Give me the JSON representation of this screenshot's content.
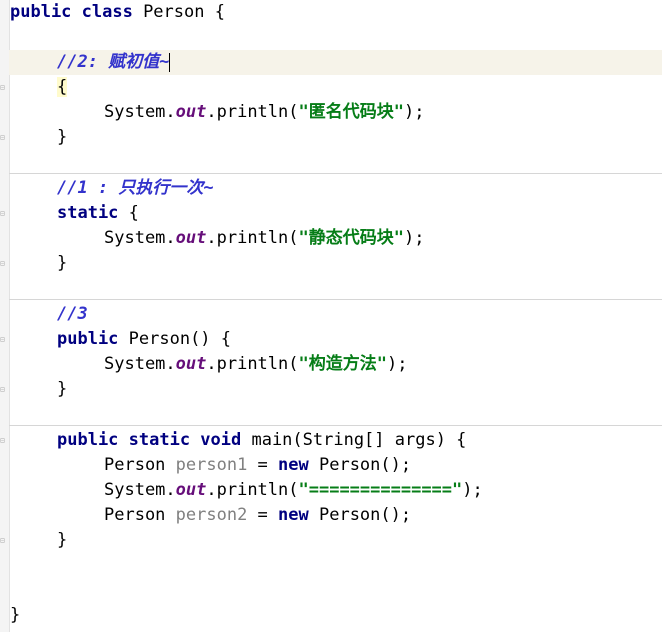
{
  "code": {
    "class_decl": {
      "kw": "public class",
      "name": " Person {"
    },
    "block1": {
      "comment": "//2: 赋初值~",
      "open": "{",
      "stmt_pre": "System.",
      "stmt_field": "out",
      "stmt_mid": ".println(",
      "stmt_str": "\"匿名代码块\"",
      "stmt_end": ");",
      "close": "}"
    },
    "block2": {
      "comment": "//1 : 只执行一次~",
      "kw": "static",
      "open": " {",
      "stmt_pre": "System.",
      "stmt_field": "out",
      "stmt_mid": ".println(",
      "stmt_str": "\"静态代码块\"",
      "stmt_end": ");",
      "close": "}"
    },
    "block3": {
      "comment": "//3",
      "kw": "public",
      "sig": " Person() {",
      "stmt_pre": "System.",
      "stmt_field": "out",
      "stmt_mid": ".println(",
      "stmt_str": "\"构造方法\"",
      "stmt_end": ");",
      "close": "}"
    },
    "main": {
      "kw": "public static void",
      "sig": " main(String[] args) {",
      "l1_type": "Person ",
      "l1_var": "person1",
      "l1_eq": " = ",
      "l1_new": "new",
      "l1_end": " Person();",
      "l2_pre": "System.",
      "l2_field": "out",
      "l2_mid": ".println(",
      "l2_str": "\"==============\"",
      "l2_end": ");",
      "l3_type": "Person ",
      "l3_var": "person2",
      "l3_eq": " = ",
      "l3_new": "new",
      "l3_end": " Person();",
      "close": "}"
    },
    "class_close": "}"
  },
  "colors": {
    "keyword": "#000080",
    "field": "#660e7a",
    "string": "#067d17",
    "comment": "#3333cc",
    "unused_var": "#808080"
  }
}
